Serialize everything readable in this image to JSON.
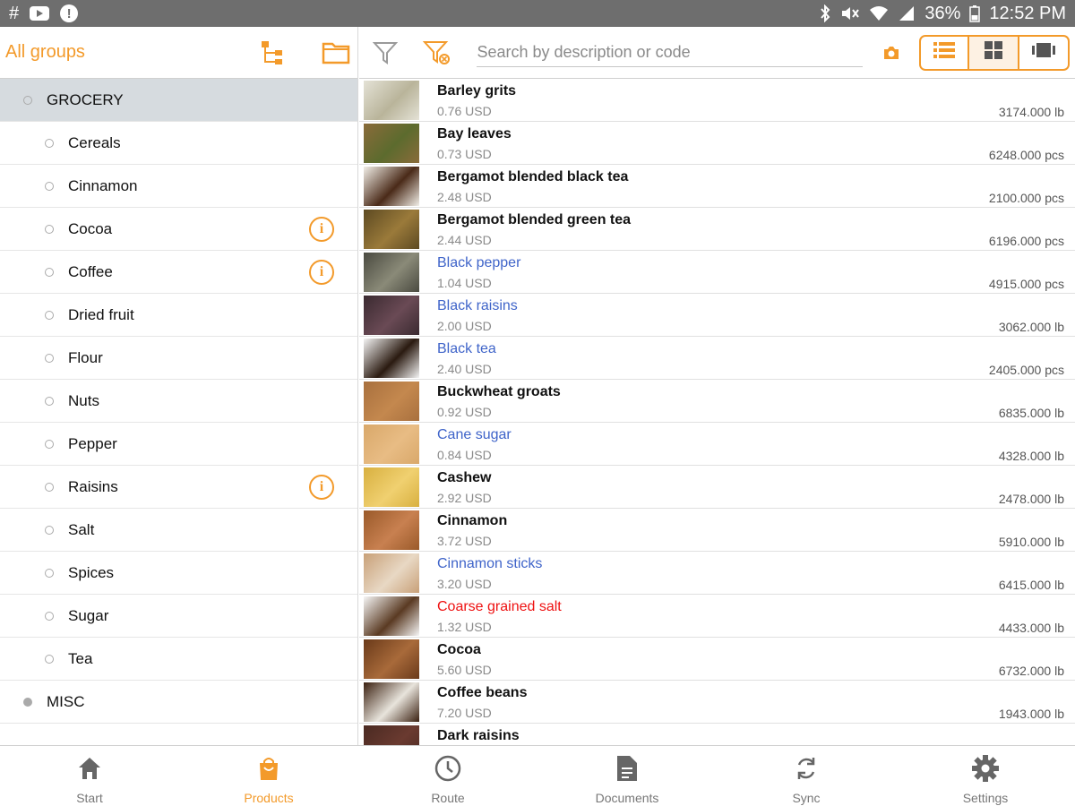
{
  "status_bar": {
    "left_icons": [
      "hash-icon",
      "youtube-icon",
      "alert-icon"
    ],
    "hash": "#",
    "battery": "36%",
    "time": "12:52 PM"
  },
  "groups_panel": {
    "title": "All groups",
    "groups": [
      {
        "label": "GROCERY",
        "level": "top",
        "selected": true,
        "info": false
      },
      {
        "label": "Cereals",
        "level": "sub",
        "selected": false,
        "info": false
      },
      {
        "label": "Cinnamon",
        "level": "sub",
        "selected": false,
        "info": false
      },
      {
        "label": "Cocoa",
        "level": "sub",
        "selected": false,
        "info": true
      },
      {
        "label": "Coffee",
        "level": "sub",
        "selected": false,
        "info": true
      },
      {
        "label": "Dried fruit",
        "level": "sub",
        "selected": false,
        "info": false
      },
      {
        "label": "Flour",
        "level": "sub",
        "selected": false,
        "info": false
      },
      {
        "label": "Nuts",
        "level": "sub",
        "selected": false,
        "info": false
      },
      {
        "label": "Pepper",
        "level": "sub",
        "selected": false,
        "info": false
      },
      {
        "label": "Raisins",
        "level": "sub",
        "selected": false,
        "info": true
      },
      {
        "label": "Salt",
        "level": "sub",
        "selected": false,
        "info": false
      },
      {
        "label": "Spices",
        "level": "sub",
        "selected": false,
        "info": false
      },
      {
        "label": "Sugar",
        "level": "sub",
        "selected": false,
        "info": false
      },
      {
        "label": "Tea",
        "level": "sub",
        "selected": false,
        "info": false
      },
      {
        "label": "MISC",
        "level": "top",
        "selected": false,
        "info": false
      }
    ],
    "info_glyph": "i"
  },
  "toolbar": {
    "search_placeholder": "Search by description or code"
  },
  "products": [
    {
      "name": "Barley grits",
      "price": "0.76 USD",
      "qty": "3174.000 lb",
      "name_color": "black",
      "thumb": [
        "#e4e2d6",
        "#b9b49a"
      ]
    },
    {
      "name": "Bay leaves",
      "price": "0.73 USD",
      "qty": "6248.000 pcs",
      "name_color": "black",
      "thumb": [
        "#8a6b3a",
        "#5c6b2e"
      ]
    },
    {
      "name": "Bergamot blended black tea",
      "price": "2.48 USD",
      "qty": "2100.000 pcs",
      "name_color": "black",
      "thumb": [
        "#f2efe8",
        "#4a2a18"
      ]
    },
    {
      "name": "Bergamot blended green tea",
      "price": "2.44 USD",
      "qty": "6196.000 pcs",
      "name_color": "black",
      "thumb": [
        "#5d4a22",
        "#9a7a3a"
      ]
    },
    {
      "name": "Black pepper",
      "price": "1.04 USD",
      "qty": "4915.000 pcs",
      "name_color": "blue",
      "thumb": [
        "#4a4a40",
        "#8a8a78"
      ]
    },
    {
      "name": "Black raisins",
      "price": "2.00 USD",
      "qty": "3062.000 lb",
      "name_color": "blue",
      "thumb": [
        "#3a2a30",
        "#6a4a55"
      ]
    },
    {
      "name": "Black tea",
      "price": "2.40 USD",
      "qty": "2405.000 pcs",
      "name_color": "blue",
      "thumb": [
        "#f4f4f4",
        "#2a1a10"
      ]
    },
    {
      "name": "Buckwheat groats",
      "price": "0.92 USD",
      "qty": "6835.000 lb",
      "name_color": "black",
      "thumb": [
        "#a8703e",
        "#c4884e"
      ]
    },
    {
      "name": "Cane sugar",
      "price": "0.84 USD",
      "qty": "4328.000 lb",
      "name_color": "blue",
      "thumb": [
        "#d9a86a",
        "#e8bc84"
      ]
    },
    {
      "name": "Cashew",
      "price": "2.92 USD",
      "qty": "2478.000 lb",
      "name_color": "black",
      "thumb": [
        "#d8b040",
        "#f0d070"
      ]
    },
    {
      "name": "Cinnamon",
      "price": "3.72 USD",
      "qty": "5910.000 lb",
      "name_color": "black",
      "thumb": [
        "#9a5a2a",
        "#c88050"
      ]
    },
    {
      "name": "Cinnamon sticks",
      "price": "3.20 USD",
      "qty": "6415.000 lb",
      "name_color": "blue",
      "thumb": [
        "#c8a078",
        "#e8d8c4"
      ]
    },
    {
      "name": "Coarse grained salt",
      "price": "1.32 USD",
      "qty": "4433.000 lb",
      "name_color": "red",
      "thumb": [
        "#f6f6f6",
        "#5a3a22"
      ]
    },
    {
      "name": "Cocoa",
      "price": "5.60 USD",
      "qty": "6732.000 lb",
      "name_color": "black",
      "thumb": [
        "#6a3a1a",
        "#a86a3a"
      ]
    },
    {
      "name": "Coffee beans",
      "price": "7.20 USD",
      "qty": "1943.000 lb",
      "name_color": "black",
      "thumb": [
        "#3a2010",
        "#e8e4dc"
      ]
    },
    {
      "name": "Dark raisins",
      "price": "",
      "qty": "",
      "name_color": "black",
      "thumb": [
        "#4a2a22",
        "#6a3a30"
      ]
    }
  ],
  "bottom_nav": [
    {
      "label": "Start",
      "icon": "home-icon",
      "active": false
    },
    {
      "label": "Products",
      "icon": "shopping-bag-icon",
      "active": true
    },
    {
      "label": "Route",
      "icon": "clock-icon",
      "active": false
    },
    {
      "label": "Documents",
      "icon": "document-icon",
      "active": false
    },
    {
      "label": "Sync",
      "icon": "sync-icon",
      "active": false
    },
    {
      "label": "Settings",
      "icon": "gear-icon",
      "active": false
    }
  ],
  "colors": {
    "accent": "#f39a2a",
    "link_blue": "#3f64c9",
    "alert_red": "#ee1111",
    "selected_row": "#d6dbdf",
    "status_bar": "#6e6e6e"
  }
}
